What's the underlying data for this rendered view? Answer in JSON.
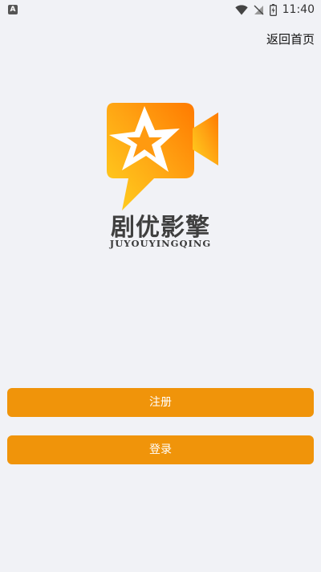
{
  "status_bar": {
    "time": "11:40",
    "icons": [
      "notification-a-icon",
      "wifi-icon",
      "no-signal-icon",
      "battery-icon"
    ]
  },
  "header": {
    "back_home_label": "返回首页"
  },
  "logo": {
    "title": "剧优影擎",
    "subtitle": "JUYOUYINGQING",
    "colors": {
      "gradient_start": "#ffd21f",
      "gradient_end": "#ff7a00"
    }
  },
  "buttons": {
    "register_label": "注册",
    "login_label": "登录",
    "color": "#f0940a"
  }
}
